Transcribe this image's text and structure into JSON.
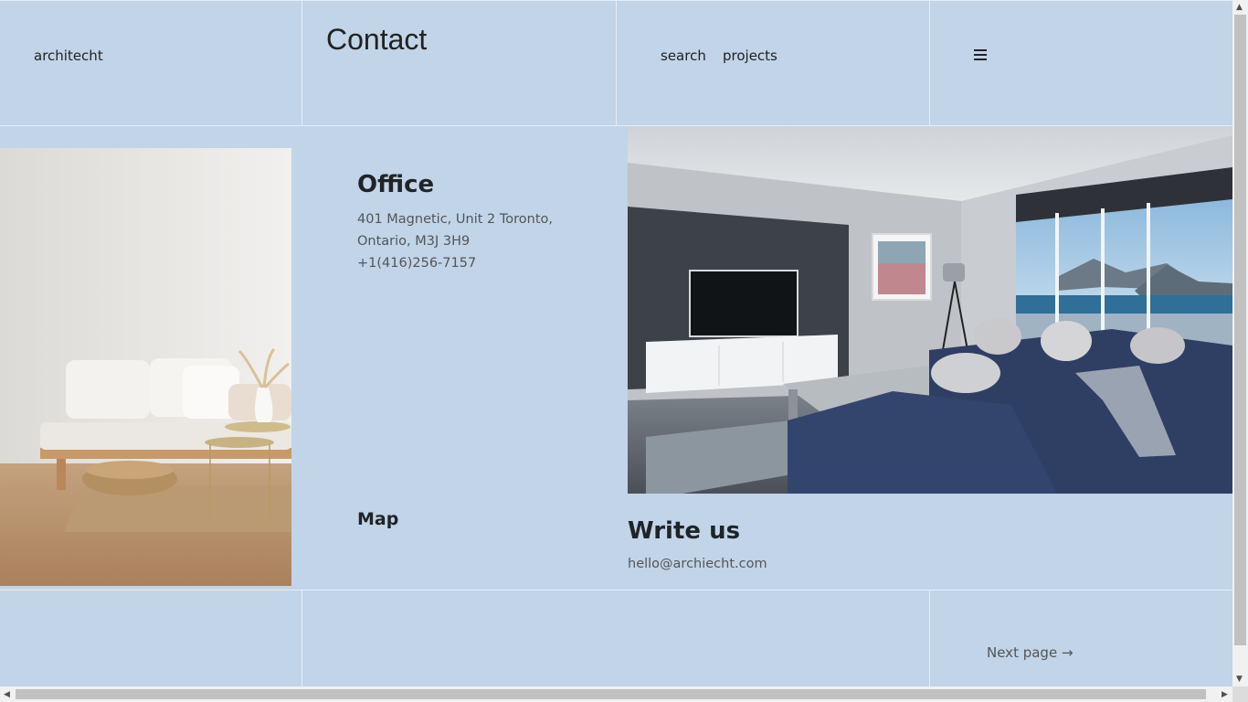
{
  "header": {
    "brand": "architecht",
    "title": "Contact",
    "nav": [
      "search",
      "projects"
    ],
    "menu_icon": "hamburger-menu-icon"
  },
  "office": {
    "title": "Office",
    "address_line1": "401 Magnetic, Unit 2 Toronto,",
    "address_line2": "Ontario, M3J 3H9",
    "phone": "+1(416)256-7157"
  },
  "map": {
    "title": "Map"
  },
  "write": {
    "title": "Write us",
    "email": "hello@archiecht.com"
  },
  "footer": {
    "next_page": "Next page →"
  },
  "colors": {
    "background": "#c1d4e8",
    "grid_lines": "#e6eef6",
    "text_dark": "#222222",
    "text_muted": "#555555"
  }
}
